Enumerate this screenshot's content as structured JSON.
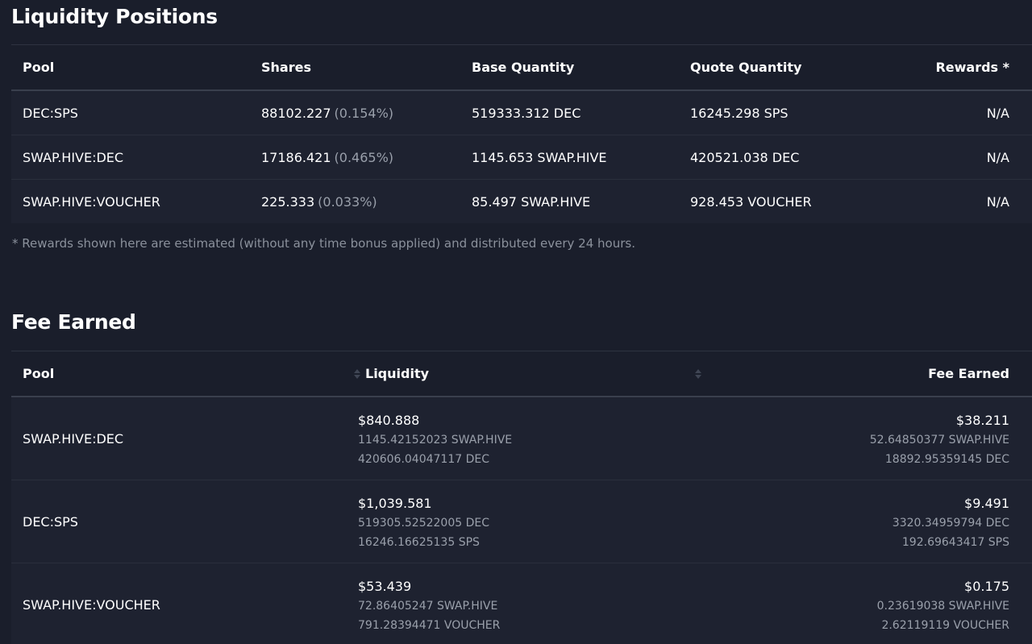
{
  "liquidity": {
    "title": "Liquidity Positions",
    "headers": {
      "pool": "Pool",
      "shares": "Shares",
      "base": "Base Quantity",
      "quote": "Quote Quantity",
      "rewards": "Rewards *"
    },
    "rows": [
      {
        "pool": "DEC:SPS",
        "shares": "88102.227",
        "share_pct": "(0.154%)",
        "base": "519333.312 DEC",
        "quote": "16245.298 SPS",
        "rewards": "N/A"
      },
      {
        "pool": "SWAP.HIVE:DEC",
        "shares": "17186.421",
        "share_pct": "(0.465%)",
        "base": "1145.653 SWAP.HIVE",
        "quote": "420521.038 DEC",
        "rewards": "N/A"
      },
      {
        "pool": "SWAP.HIVE:VOUCHER",
        "shares": "225.333",
        "share_pct": "(0.033%)",
        "base": "85.497 SWAP.HIVE",
        "quote": "928.453 VOUCHER",
        "rewards": "N/A"
      }
    ],
    "footnote": "* Rewards shown here are estimated (without any time bonus applied) and distributed every 24 hours."
  },
  "fees": {
    "title": "Fee Earned",
    "headers": {
      "pool": "Pool",
      "liquidity": "Liquidity",
      "fee": "Fee Earned"
    },
    "rows": [
      {
        "pool": "SWAP.HIVE:DEC",
        "liquidity": "$840.888",
        "liq_base": "1145.42152023 SWAP.HIVE",
        "liq_quote": "420606.04047117 DEC",
        "fee": "$38.211",
        "fee_base": "52.64850377 SWAP.HIVE",
        "fee_quote": "18892.95359145 DEC"
      },
      {
        "pool": "DEC:SPS",
        "liquidity": "$1,039.581",
        "liq_base": "519305.52522005 DEC",
        "liq_quote": "16246.16625135 SPS",
        "fee": "$9.491",
        "fee_base": "3320.34959794 DEC",
        "fee_quote": "192.69643417 SPS"
      },
      {
        "pool": "SWAP.HIVE:VOUCHER",
        "liquidity": "$53.439",
        "liq_base": "72.86405247 SWAP.HIVE",
        "liq_quote": "791.28394471 VOUCHER",
        "fee": "$0.175",
        "fee_base": "0.23619038 SWAP.HIVE",
        "fee_quote": "2.62119119 VOUCHER"
      }
    ],
    "sort_icons": [
      "sort-icon",
      "sort-icon"
    ]
  },
  "colors": {
    "background": "#1a1e2b",
    "row_background": "#1e2230",
    "muted_text": "#9aa0ab",
    "text": "#ffffff"
  }
}
